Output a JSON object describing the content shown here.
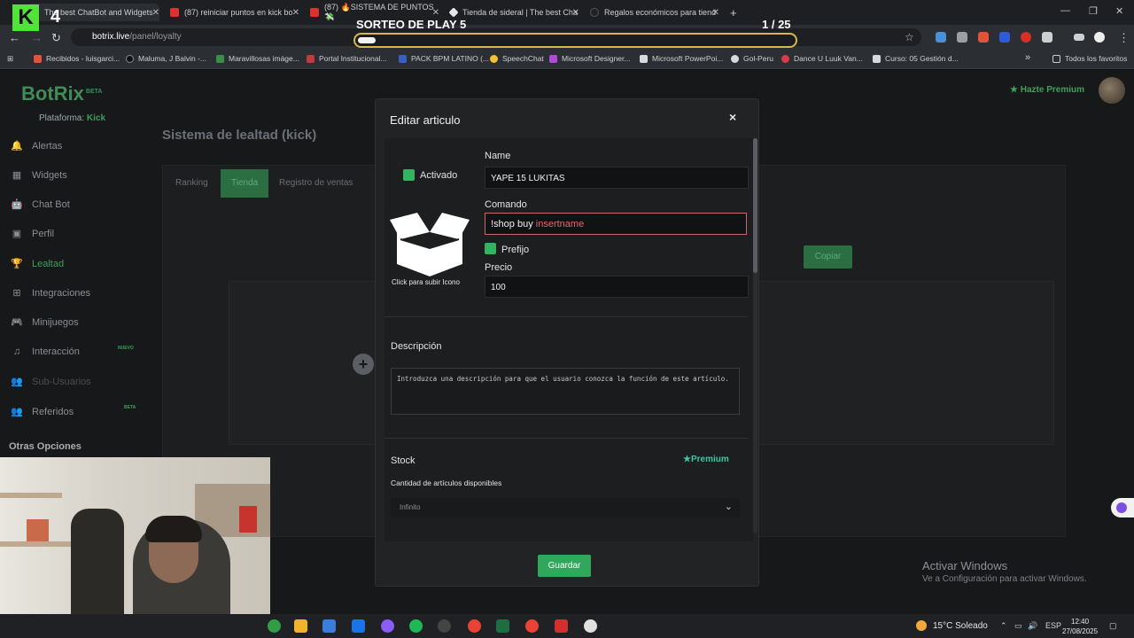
{
  "browser": {
    "tabs": [
      {
        "label": "The best ChatBot and Widgets",
        "color": "#2b6b3c"
      },
      {
        "label": "(87) reiniciar puntos en kick bo",
        "color": "#e03131"
      },
      {
        "label": "(87) 🔥SISTEMA DE PUNTOS 💸",
        "color": "#e03131"
      },
      {
        "label": "Tienda de sideral | The best Cha",
        "color": "#e6e6e6"
      },
      {
        "label": "Regalos económicos para tiend",
        "color": "#222"
      }
    ],
    "new_tab": "+",
    "url_host": "botrix.live",
    "url_path": "/panel/loyalty",
    "bookmarks": [
      "Recibidos - luisgarci...",
      "Maluma, J Balvin -...",
      "Maravillosas imáge...",
      "Portal Institucional...",
      "PACK BPM LATINO (...",
      "SpeechChat",
      "Microsoft Designer...",
      "Microsoft PowerPoi...",
      "Gol-Peru",
      "Dance U Luuk Van...",
      "Curso: 05 Gestión d..."
    ],
    "bookmarks_more": "»",
    "all_bookmarks": "Todos los favoritos"
  },
  "overlay": {
    "kick_letter": "K",
    "kick_number": "4",
    "sorteo_title": "SORTEO DE PLAY 5",
    "sorteo_count": "1   / 25",
    "sorteo_progress": 0.04
  },
  "sidebar": {
    "logo": "BotRix",
    "logo_beta": "BETA",
    "platform_label": "Plataforma:",
    "platform_value": "Kick",
    "items": [
      {
        "label": "Alertas",
        "icon": "🔔"
      },
      {
        "label": "Widgets",
        "icon": "▦"
      },
      {
        "label": "Chat Bot",
        "icon": "🤖"
      },
      {
        "label": "Perfil",
        "icon": "▣"
      },
      {
        "label": "Lealtad",
        "icon": "🏆"
      },
      {
        "label": "Integraciones",
        "icon": "⊞"
      },
      {
        "label": "Minijuegos",
        "icon": "🎮"
      },
      {
        "label": "Interacción",
        "icon": "♫"
      },
      {
        "label": "Sub-Usuarios",
        "icon": "👥"
      },
      {
        "label": "Referidos",
        "icon": "👥"
      }
    ],
    "badge_nuevo": "NUEVO",
    "badge_beta": "BETA",
    "otras": "Otras Opciones"
  },
  "header": {
    "premium": "Hazte Premium"
  },
  "main": {
    "title": "Sistema de lealtad (kick)",
    "tabs": [
      "Ranking",
      "Tienda",
      "Registro de ventas"
    ],
    "copy_button": "Copiar"
  },
  "modal": {
    "title": "Editar articulo",
    "close": "×",
    "activado": "Activado",
    "upload": "Click para subir Icono",
    "name_label": "Name",
    "name_value": "YAPE 15 LUKITAS",
    "command_label": "Comando",
    "command_value": "!shop buy ",
    "command_placeholder": "insertname",
    "prefijo": "Prefijo",
    "price_label": "Precio",
    "price_value": "100",
    "description_label": "Descripción",
    "description_placeholder": "Introduzca una descripción para que el usuario conozca la función de este artículo.",
    "stock_label": "Stock",
    "premium_badge": "Premium",
    "stock_sub": "Cantidad de artículos disponibles",
    "stock_value": "Infinito",
    "save": "Guardar"
  },
  "watermark": {
    "title": "Activar Windows",
    "subtitle": "Ve a Configuración para activar Windows."
  },
  "taskbar": {
    "weather": "15°C  Soleado",
    "lang": "ESP",
    "time": "12:40",
    "date": "27/08/2025"
  }
}
